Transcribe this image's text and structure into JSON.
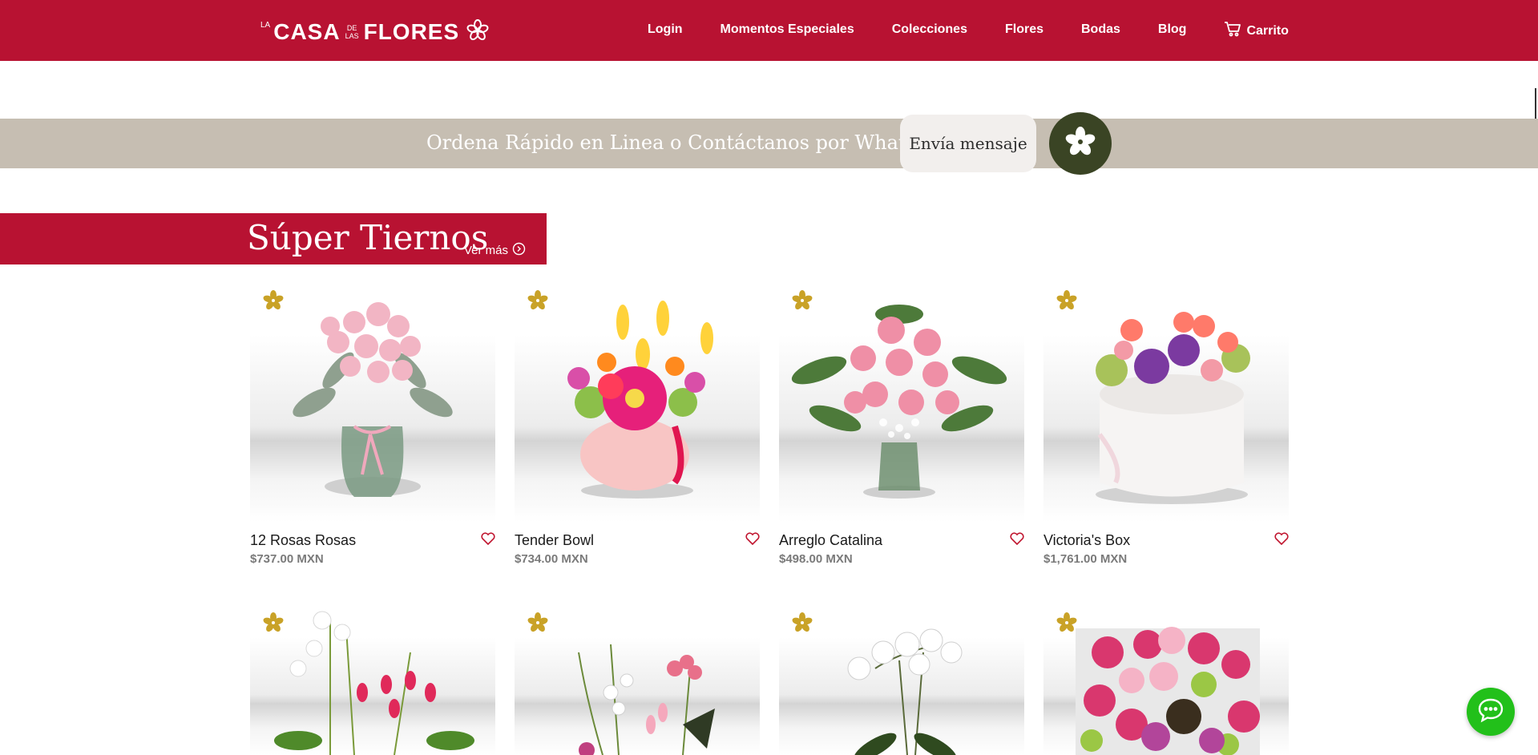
{
  "header": {
    "logo": {
      "la": "LA",
      "casa": "CASA",
      "de": "DE",
      "las": "LAS",
      "flores": "FLORES"
    },
    "nav": [
      {
        "label": "Login"
      },
      {
        "label": "Momentos Especiales"
      },
      {
        "label": "Colecciones"
      },
      {
        "label": "Flores"
      },
      {
        "label": "Bodas"
      },
      {
        "label": "Blog"
      }
    ],
    "cart_label": "Carrito",
    "colors": {
      "brand": "#b81232"
    }
  },
  "banner": {
    "text": "Ordena Rápido en Linea o Contáctanos por Whatsapp",
    "button_label": "Envía mensaje",
    "colors": {
      "background": "#c6beb2",
      "circle": "#3a4424"
    }
  },
  "section": {
    "title": "Súper Tiernos",
    "ver_mas": "Ver más"
  },
  "products": [
    {
      "name": "12 Rosas Rosas",
      "price": "$737.00 MXN"
    },
    {
      "name": "Tender Bowl",
      "price": "$734.00 MXN"
    },
    {
      "name": "Arreglo Catalina",
      "price": "$498.00 MXN"
    },
    {
      "name": "Victoria's Box",
      "price": "$1,761.00 MXN"
    },
    {
      "name": "",
      "price": ""
    },
    {
      "name": "",
      "price": ""
    },
    {
      "name": "",
      "price": ""
    },
    {
      "name": "",
      "price": ""
    }
  ],
  "chat": {
    "icon": "chat-bubble-icon",
    "color": "#22c01a"
  }
}
